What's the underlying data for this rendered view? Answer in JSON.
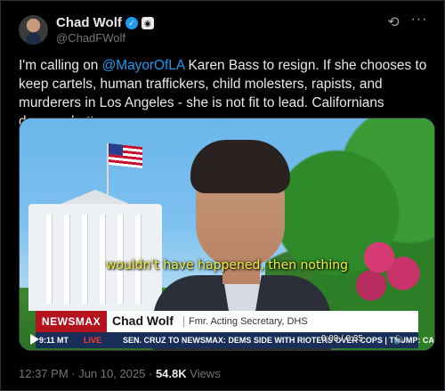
{
  "author": {
    "name": "Chad Wolf",
    "handle": "@ChadFWolf"
  },
  "tweet": {
    "text_before": "I'm calling on ",
    "mention": "@MayorOfLA",
    "text_after": " Karen Bass to resign. If she chooses to keep cartels, human traffickers, child molesters, rapists, and murderers in Los Angeles - she is not fit to lead. Californians deserve better."
  },
  "video": {
    "caption": "wouldn't have happened, then nothing",
    "network": "NEWSMAX",
    "lower_third_name": "Chad Wolf",
    "lower_third_title": "Fmr. Acting Secretary, DHS",
    "ticker_time": "9:11 MT",
    "ticker_live": "LIVE",
    "ticker_text": "SEN. CRUZ TO NEWSMAX: DEMS SIDE WITH RIOTERS OVER COPS | TRUMP: CALL GOV",
    "time_display": "0:08 / 0:35"
  },
  "meta": {
    "timestamp": "12:37 PM · Jun 10, 2025 · ",
    "views_count": "54.8K",
    "views_label": " Views"
  },
  "icons": {
    "verified": "verified-badge-icon",
    "affiliate": "affiliate-badge-icon",
    "grok": "grok-icon",
    "more": "more-icon",
    "play": "play-icon",
    "volume": "volume-icon"
  },
  "colors": {
    "accent": "#1d9bf0",
    "background": "#000000",
    "secondary_text": "#71767b",
    "newsmax_red": "#b4131e"
  }
}
